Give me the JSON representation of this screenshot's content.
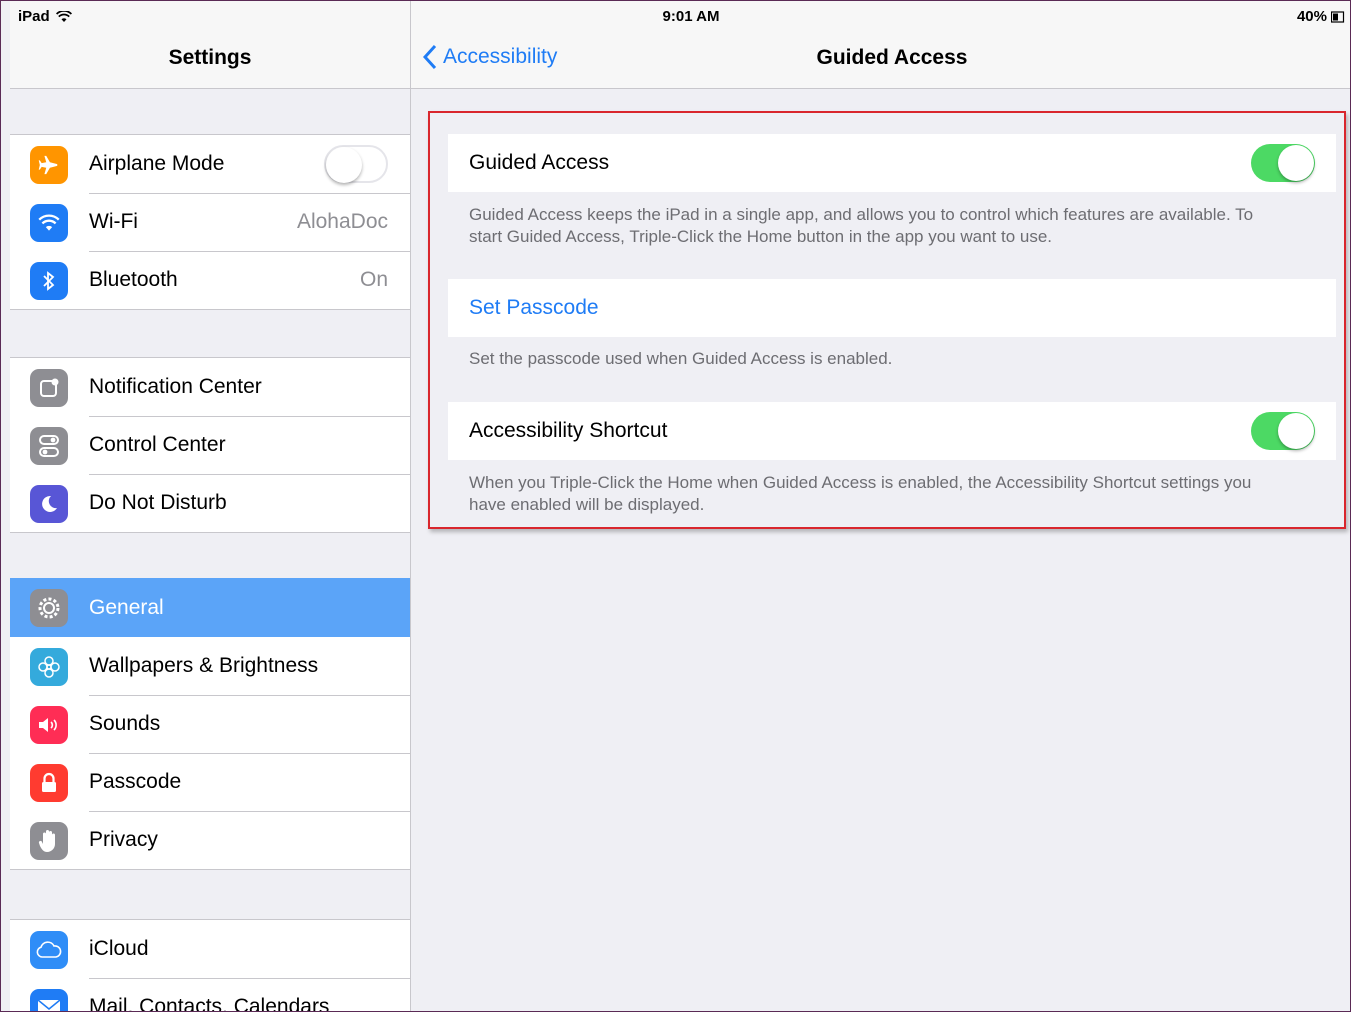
{
  "status_bar": {
    "device": "iPad",
    "time": "9:01 AM",
    "battery": "40%"
  },
  "master": {
    "title": "Settings",
    "group1": [
      {
        "icon": "airplane-icon",
        "label": "Airplane Mode",
        "toggle": "off",
        "color": "#ff9500"
      },
      {
        "icon": "wifi-icon",
        "label": "Wi-Fi",
        "value": "AlohaDoc",
        "color": "#1f7cf5"
      },
      {
        "icon": "bluetooth-icon",
        "label": "Bluetooth",
        "value": "On",
        "color": "#1f7cf5"
      }
    ],
    "group2": [
      {
        "icon": "notification-center-icon",
        "label": "Notification Center",
        "color": "#8e8e93"
      },
      {
        "icon": "control-center-icon",
        "label": "Control Center",
        "color": "#8e8e93"
      },
      {
        "icon": "moon-icon",
        "label": "Do Not Disturb",
        "color": "#5856d6"
      }
    ],
    "group3": [
      {
        "icon": "gear-icon",
        "label": "General",
        "selected": true,
        "color": "#8e8e93"
      },
      {
        "icon": "flower-icon",
        "label": "Wallpapers & Brightness",
        "color": "#34aadc"
      },
      {
        "icon": "speaker-icon",
        "label": "Sounds",
        "color": "#ff2d55"
      },
      {
        "icon": "lock-icon",
        "label": "Passcode",
        "color": "#ff3b30"
      },
      {
        "icon": "hand-icon",
        "label": "Privacy",
        "color": "#8e8e93"
      }
    ],
    "group4": [
      {
        "icon": "cloud-icon",
        "label": "iCloud",
        "color": "#2f8df7"
      },
      {
        "icon": "mail-icon",
        "label": "Mail, Contacts, Calendars",
        "color": "#1f7cf5"
      }
    ]
  },
  "detail": {
    "back_label": "Accessibility",
    "title": "Guided Access",
    "guided_access": {
      "label": "Guided Access",
      "enabled": true
    },
    "guided_access_note": "Guided Access keeps the iPad in a single app, and allows you to control which features are available. To start Guided Access, Triple-Click the Home button in the app you want to use.",
    "set_passcode": {
      "label": "Set Passcode"
    },
    "set_passcode_note": "Set the passcode used when Guided Access is enabled.",
    "accessibility_shortcut": {
      "label": "Accessibility Shortcut",
      "enabled": true
    },
    "shortcut_note": "When you Triple-Click the Home when Guided Access is enabled, the Accessibility Shortcut settings you have enabled will be displayed."
  },
  "colors": {
    "accent": "#1f7cf5",
    "toggle_on": "#4cd964",
    "selected_row": "#5ba4f8",
    "highlight_box": "#d9262d"
  }
}
